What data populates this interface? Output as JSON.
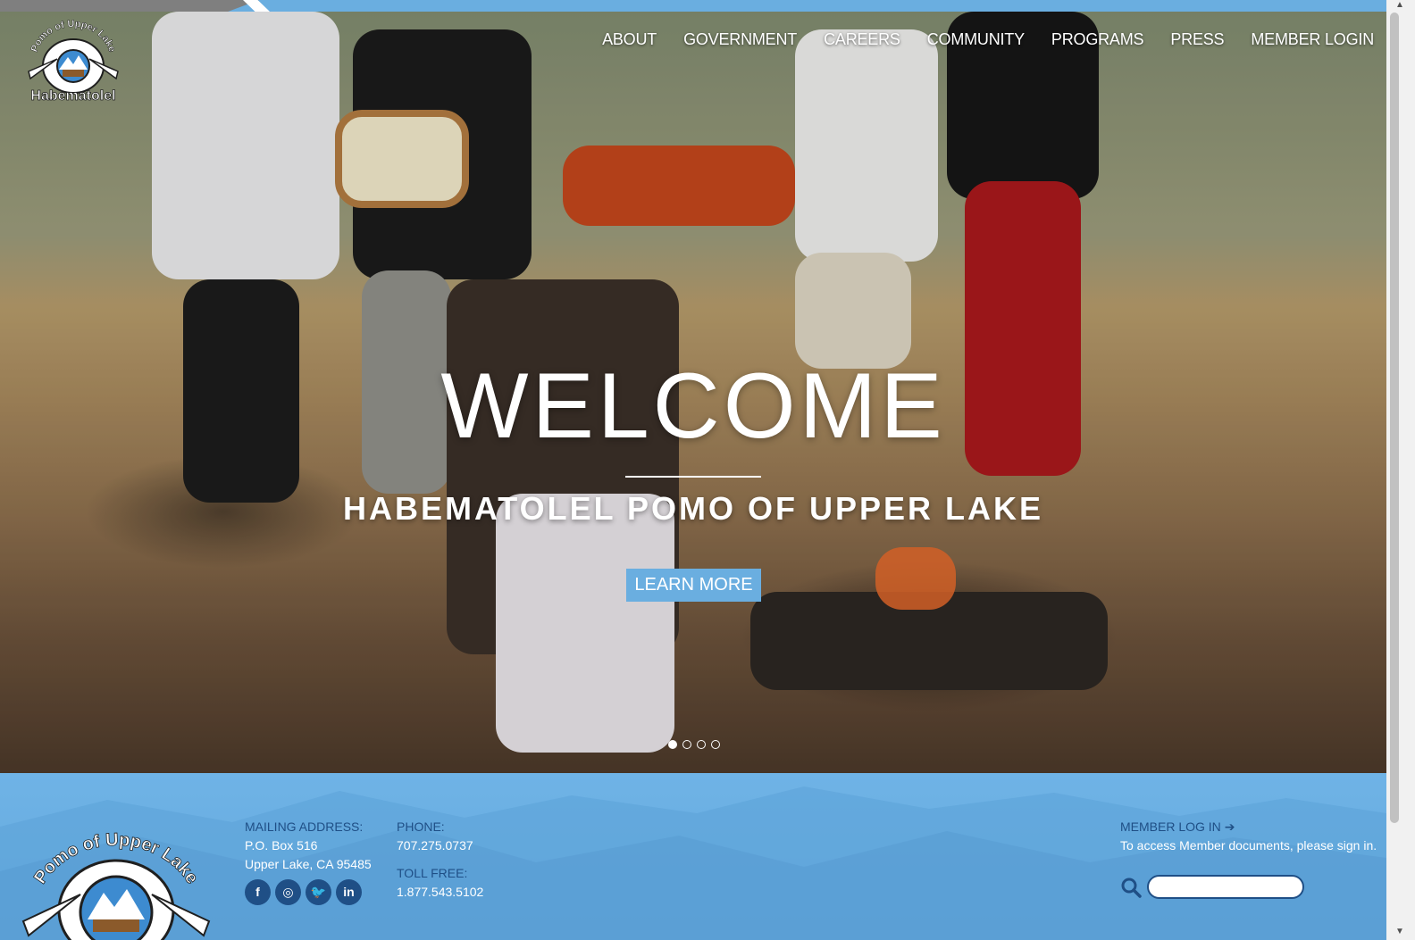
{
  "nav": {
    "items": [
      "ABOUT",
      "GOVERNMENT",
      "CAREERS",
      "COMMUNITY",
      "PROGRAMS",
      "PRESS",
      "MEMBER LOGIN"
    ]
  },
  "logo": {
    "arc_text": "Pomo of Upper Lake",
    "name_text": "Habematolel"
  },
  "hero": {
    "title": "WELCOME",
    "subtitle": "HABEMATOLEL POMO OF UPPER LAKE",
    "button_label": "LEARN MORE",
    "slides": 4,
    "active_slide": 1
  },
  "footer": {
    "mailing_label": "MAILING ADDRESS:",
    "mailing_line1": "P.O. Box 516",
    "mailing_line2": "Upper Lake, CA 95485",
    "phone_label": "PHONE:",
    "phone_value": "707.275.0737",
    "tollfree_label": "TOLL FREE:",
    "tollfree_value": "1.877.543.5102",
    "member_link": "MEMBER LOG IN",
    "member_text": "To access Member documents, please sign in.",
    "social_icons": [
      "facebook-icon",
      "instagram-icon",
      "twitter-icon",
      "linkedin-icon"
    ],
    "search_placeholder": ""
  },
  "colors": {
    "accent_blue": "#6aaee0",
    "dark_blue": "#1f4f86",
    "white": "#ffffff"
  }
}
